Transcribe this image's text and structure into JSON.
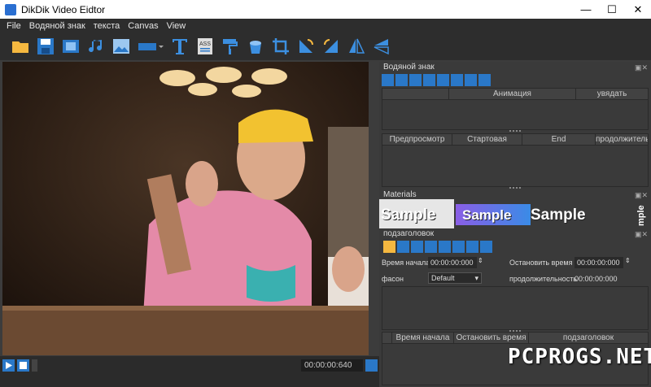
{
  "window": {
    "title": "DikDik Video Eidtor"
  },
  "menu": [
    "File",
    "Водяной знак",
    "текста",
    "Canvas",
    "View"
  ],
  "toolbar": {
    "icons": [
      "folder-open-icon",
      "save-icon",
      "video-clip-icon",
      "music-icon",
      "image-icon",
      "shape-icon",
      "text-icon",
      "ass-subtitle-icon",
      "paint-roller-icon",
      "bucket-icon",
      "crop-icon",
      "rotate-left-icon",
      "rotate-right-icon",
      "flip-horizontal-icon",
      "flip-vertical-icon"
    ],
    "ass_label": "ASS"
  },
  "watermark_panel": {
    "title": "Водяной знак",
    "animation_cols": [
      "",
      "Анимация",
      "увядать"
    ],
    "timing_cols": [
      "Предпросмотр",
      "Стартовая",
      "End",
      "продолжительность"
    ]
  },
  "materials_panel": {
    "title": "Materials",
    "samples": [
      "Sample",
      "Sample",
      "Sample",
      "mple"
    ]
  },
  "subtitle_panel": {
    "title": "подзаголовок",
    "start_label": "Время начала",
    "start_value": "00:00:00:000",
    "stop_label": "Остановить время",
    "stop_value": "00:00:00:000",
    "style_label": "фасон",
    "style_value": "Default",
    "duration_label": "продолжительность",
    "duration_value": "00:00:00:000",
    "table_cols": [
      "Время начала",
      "Остановить время",
      "подзаголовок"
    ]
  },
  "transport": {
    "timecode": "00:00:00:640"
  },
  "overlay_watermark": "PCPROGS.NET",
  "colors": {
    "accent": "#2a78c8",
    "panel": "#3a3a3a",
    "toolbar": "#2d2d2d"
  }
}
